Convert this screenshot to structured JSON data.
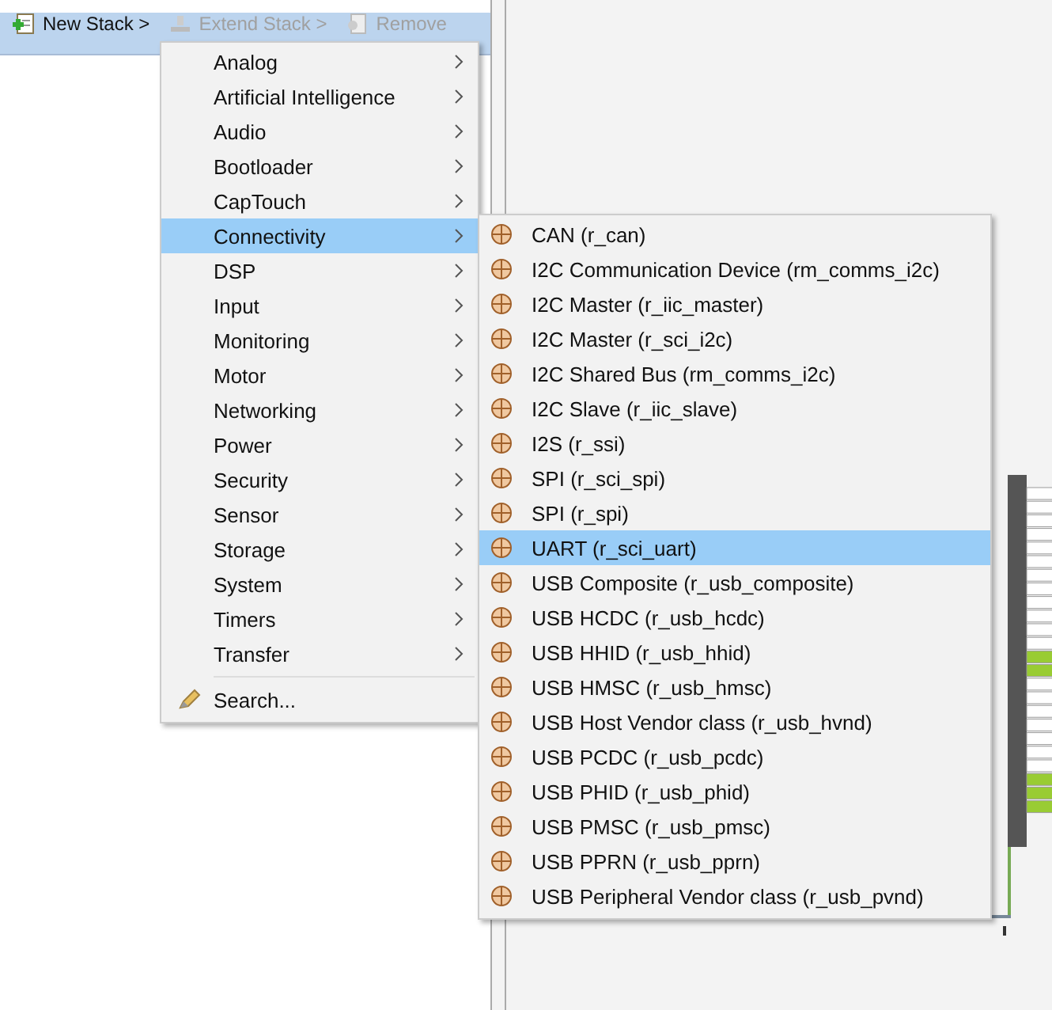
{
  "toolbar": {
    "buttons": [
      {
        "label": "New Stack >",
        "kind": "new",
        "disabled": false
      },
      {
        "label": "Extend Stack >",
        "kind": "extend",
        "disabled": true
      },
      {
        "label": "Remove",
        "kind": "remove",
        "disabled": true
      }
    ]
  },
  "menu": {
    "items": [
      {
        "label": "Analog",
        "kind": "submenu",
        "selected": false
      },
      {
        "label": "Artificial Intelligence",
        "kind": "submenu",
        "selected": false
      },
      {
        "label": "Audio",
        "kind": "submenu",
        "selected": false
      },
      {
        "label": "Bootloader",
        "kind": "submenu",
        "selected": false
      },
      {
        "label": "CapTouch",
        "kind": "submenu",
        "selected": false
      },
      {
        "label": "Connectivity",
        "kind": "submenu",
        "selected": true
      },
      {
        "label": "DSP",
        "kind": "submenu",
        "selected": false
      },
      {
        "label": "Input",
        "kind": "submenu",
        "selected": false
      },
      {
        "label": "Monitoring",
        "kind": "submenu",
        "selected": false
      },
      {
        "label": "Motor",
        "kind": "submenu",
        "selected": false
      },
      {
        "label": "Networking",
        "kind": "submenu",
        "selected": false
      },
      {
        "label": "Power",
        "kind": "submenu",
        "selected": false
      },
      {
        "label": "Security",
        "kind": "submenu",
        "selected": false
      },
      {
        "label": "Sensor",
        "kind": "submenu",
        "selected": false
      },
      {
        "label": "Storage",
        "kind": "submenu",
        "selected": false
      },
      {
        "label": "System",
        "kind": "submenu",
        "selected": false
      },
      {
        "label": "Timers",
        "kind": "submenu",
        "selected": false
      },
      {
        "label": "Transfer",
        "kind": "submenu",
        "selected": false
      },
      {
        "label": "Search...",
        "kind": "search",
        "selected": false
      }
    ]
  },
  "submenu": {
    "items": [
      {
        "label": "CAN (r_can)",
        "selected": false
      },
      {
        "label": "I2C Communication Device (rm_comms_i2c)",
        "selected": false
      },
      {
        "label": "I2C Master (r_iic_master)",
        "selected": false
      },
      {
        "label": "I2C Master (r_sci_i2c)",
        "selected": false
      },
      {
        "label": "I2C Shared Bus (rm_comms_i2c)",
        "selected": false
      },
      {
        "label": "I2C Slave (r_iic_slave)",
        "selected": false
      },
      {
        "label": "I2S (r_ssi)",
        "selected": false
      },
      {
        "label": "SPI (r_sci_spi)",
        "selected": false
      },
      {
        "label": "SPI (r_spi)",
        "selected": false
      },
      {
        "label": "UART (r_sci_uart)",
        "selected": true
      },
      {
        "label": "USB Composite (r_usb_composite)",
        "selected": false
      },
      {
        "label": "USB HCDC (r_usb_hcdc)",
        "selected": false
      },
      {
        "label": "USB HHID (r_usb_hhid)",
        "selected": false
      },
      {
        "label": "USB HMSC (r_usb_hmsc)",
        "selected": false
      },
      {
        "label": "USB Host Vendor class (r_usb_hvnd)",
        "selected": false
      },
      {
        "label": "USB PCDC (r_usb_pcdc)",
        "selected": false
      },
      {
        "label": "USB PHID (r_usb_phid)",
        "selected": false
      },
      {
        "label": "USB PMSC (r_usb_pmsc)",
        "selected": false
      },
      {
        "label": "USB PPRN (r_usb_pprn)",
        "selected": false
      },
      {
        "label": "USB Peripheral Vendor class (r_usb_pvnd)",
        "selected": false
      }
    ]
  }
}
